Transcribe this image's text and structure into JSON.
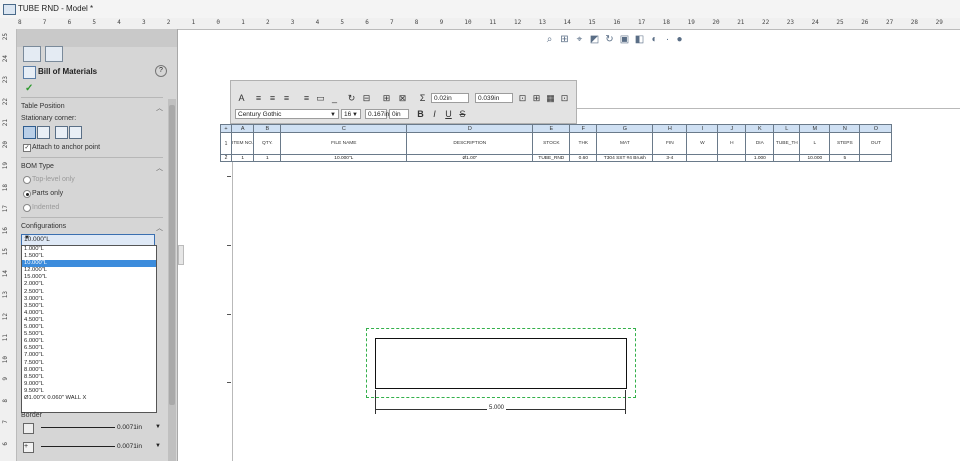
{
  "window": {
    "title": "TUBE RND - Model *"
  },
  "ruler_top": [
    "8",
    "7",
    "6",
    "5",
    "4",
    "3",
    "2",
    "1",
    "0",
    "1",
    "2",
    "3",
    "4",
    "5",
    "6",
    "7",
    "8",
    "9",
    "10",
    "11",
    "12",
    "13",
    "14",
    "15",
    "16",
    "17",
    "18",
    "19",
    "20",
    "21",
    "22",
    "23",
    "24",
    "25",
    "26",
    "27",
    "28",
    "29"
  ],
  "ruler_left": [
    "25",
    "24",
    "23",
    "22",
    "21",
    "20",
    "19",
    "18",
    "17",
    "16",
    "15",
    "14",
    "13",
    "12",
    "11",
    "10",
    "9",
    "8",
    "7",
    "6"
  ],
  "property_manager": {
    "title": "Bill of Materials",
    "help": "?",
    "ok": "✓",
    "table_position": {
      "header": "Table Position",
      "stationary_corner": "Stationary corner:",
      "attach_to_anchor": "Attach to anchor point"
    },
    "bom_type": {
      "header": "BOM Type",
      "options": [
        "Top-level only",
        "Parts only",
        "Indented"
      ],
      "selected": "Parts only"
    },
    "configurations": {
      "header": "Configurations",
      "selected": "10.000\"L",
      "list": [
        "1.000\"L",
        "1.500\"L",
        "10.000\"L",
        "12.000\"L",
        "15.000\"L",
        "2.000\"L",
        "2.500\"L",
        "3.000\"L",
        "3.500\"L",
        "4.000\"L",
        "4.500\"L",
        "5.000\"L",
        "5.500\"L",
        "6.000\"L",
        "6.500\"L",
        "7.000\"L",
        "7.500\"L",
        "8.000\"L",
        "8.500\"L",
        "9.000\"L",
        "9.500\"L",
        "Ø1.00\"X 0.060\" WALL X"
      ],
      "highlighted": "10.000\"L"
    },
    "border": {
      "header": "Border",
      "box_border": "0.0071in",
      "grid_border": "0.0071in"
    }
  },
  "format_toolbar": {
    "font": "Century Gothic",
    "size": "16",
    "height": "0.167in",
    "indent": "0in",
    "margin1": "0.02in",
    "margin2": "0.039in",
    "sum": "Σ",
    "bold": "B",
    "italic": "I",
    "underline": "U",
    "strike": "S"
  },
  "bom_table": {
    "letters": [
      "A",
      "B",
      "C",
      "D",
      "E",
      "F",
      "G",
      "H",
      "I",
      "J",
      "K",
      "L",
      "M",
      "N",
      "O"
    ],
    "headers": [
      "ITEM NO.",
      "QTY.",
      "FILE NAME",
      "DESCRIPTION",
      "STOCK",
      "THK",
      "MAT",
      "FIN",
      "W",
      "H",
      "DIA",
      "TUBE_TH",
      "L",
      "STEPS",
      "OUT"
    ],
    "row_labels": [
      "1",
      "2"
    ],
    "rows": [
      [
        "1",
        "1",
        "10.000\"L",
        "Ø1.00\"",
        "TUBE_RND",
        "0.60",
        "T304 SST #4 Brush",
        "3-4",
        "",
        "",
        "1.000",
        "",
        "10.000",
        "5",
        ""
      ]
    ]
  },
  "drawing": {
    "dimension": "5.000"
  },
  "colors": {
    "accent": "#3c8cdc",
    "ok_green": "#2f9a2f",
    "view_box": "#33b04a"
  }
}
